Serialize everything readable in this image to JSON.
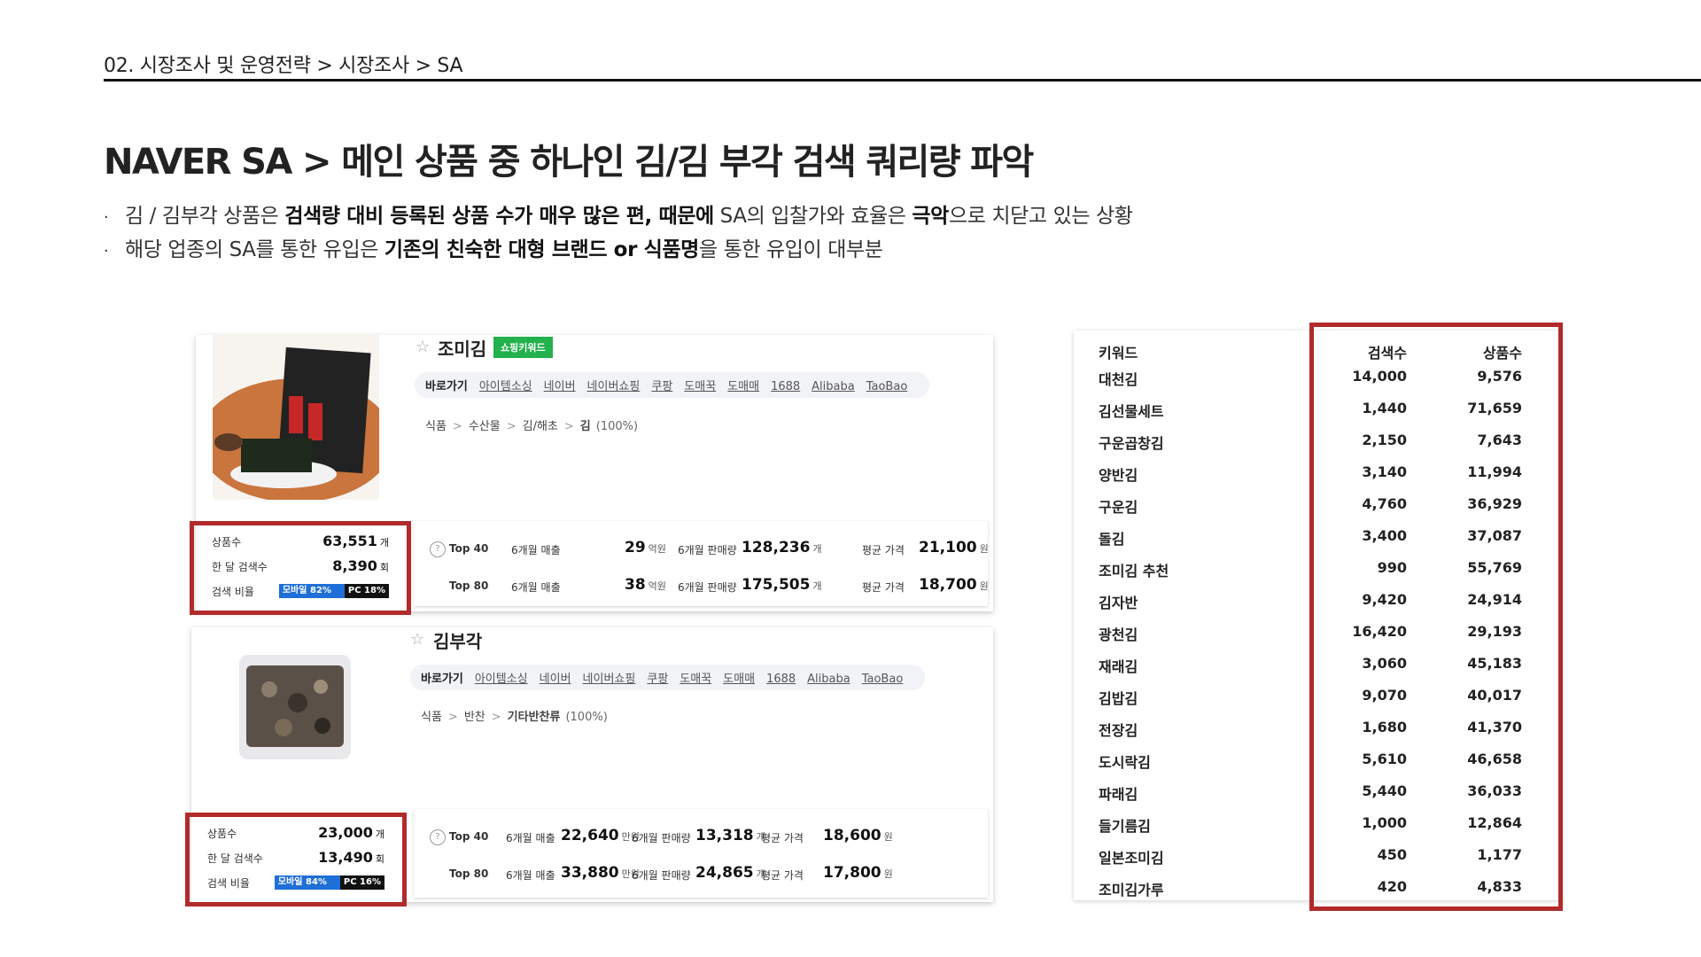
{
  "breadcrumb": "02. 시장조사 및 운영전략  >  시장조사 > SA",
  "title": "NAVER SA >  메인 상품 중 하나인 김/김 부각 검색 쿼리량 파악",
  "bullets": [
    {
      "parts": [
        {
          "t": "김 / 김부각 상품은 ",
          "b": false
        },
        {
          "t": "검색량 대비 등록된 상품 수가 매우 많은 편, 때문에",
          "b": true
        },
        {
          "t": " SA의 입찰가와 효율은 ",
          "b": false
        },
        {
          "t": "극악",
          "b": true
        },
        {
          "t": "으로 치닫고 있는 상황",
          "b": false
        }
      ]
    },
    {
      "parts": [
        {
          "t": "해당 업종의 SA를 통한 유입은 ",
          "b": false
        },
        {
          "t": "기존의 친숙한 대형 브랜드 or 식품명",
          "b": true
        },
        {
          "t": "을 통한 유입이 대부분",
          "b": false
        }
      ]
    }
  ],
  "card1": {
    "name": "조미김",
    "badge": "쇼핑키워드",
    "links": [
      "바로가기",
      "아이템소싱",
      "네이버",
      "네이버쇼핑",
      "쿠팡",
      "도매꾹",
      "도매매",
      "1688",
      "Alibaba",
      "TaoBao"
    ],
    "category": [
      "식품",
      "수산물",
      "김/해초",
      "김"
    ],
    "category_pct": "(100%)",
    "stats": {
      "products_label": "상품수",
      "products": "63,551",
      "products_unit": "개",
      "monthly_label": "한 달 검색수",
      "monthly": "8,390",
      "monthly_unit": "회",
      "ratio_label": "검색 비율",
      "mobile": "모바일 82%",
      "pc": "PC 18%",
      "mobile_pct": 82
    },
    "sales": [
      {
        "top": "Top 40",
        "rev_label": "6개월 매출",
        "rev": "29",
        "rev_unit": "억원",
        "qty_label": "6개월 판매량",
        "qty": "128,236",
        "qty_unit": "개",
        "price_label": "평균 가격",
        "price": "21,100",
        "price_unit": "원"
      },
      {
        "top": "Top 80",
        "rev_label": "6개월 매출",
        "rev": "38",
        "rev_unit": "억원",
        "qty_label": "6개월 판매량",
        "qty": "175,505",
        "qty_unit": "개",
        "price_label": "평균 가격",
        "price": "18,700",
        "price_unit": "원"
      }
    ]
  },
  "card2": {
    "name": "김부각",
    "links": [
      "바로가기",
      "아이템소싱",
      "네이버",
      "네이버쇼핑",
      "쿠팡",
      "도매꾹",
      "도매매",
      "1688",
      "Alibaba",
      "TaoBao"
    ],
    "category": [
      "식품",
      "반찬",
      "기타반찬류"
    ],
    "category_pct": "(100%)",
    "stats": {
      "products_label": "상품수",
      "products": "23,000",
      "products_unit": "개",
      "monthly_label": "한 달 검색수",
      "monthly": "13,490",
      "monthly_unit": "회",
      "ratio_label": "검색 비율",
      "mobile": "모바일 84%",
      "pc": "PC 16%",
      "mobile_pct": 84
    },
    "sales": [
      {
        "top": "Top 40",
        "rev_label": "6개월 매출",
        "rev": "22,640",
        "rev_unit": "만원",
        "qty_label": "6개월 판매량",
        "qty": "13,318",
        "qty_unit": "개",
        "price_label": "평균 가격",
        "price": "18,600",
        "price_unit": "원"
      },
      {
        "top": "Top 80",
        "rev_label": "6개월 매출",
        "rev": "33,880",
        "rev_unit": "만원",
        "qty_label": "6개월 판매량",
        "qty": "24,865",
        "qty_unit": "개",
        "price_label": "평균 가격",
        "price": "17,800",
        "price_unit": "원"
      }
    ]
  },
  "keyword_table": {
    "headers": [
      "키워드",
      "검색수",
      "상품수"
    ],
    "rows": [
      [
        "대천김",
        "14,000",
        "9,576"
      ],
      [
        "김선물세트",
        "1,440",
        "71,659"
      ],
      [
        "구운곱창김",
        "2,150",
        "7,643"
      ],
      [
        "양반김",
        "3,140",
        "11,994"
      ],
      [
        "구운김",
        "4,760",
        "36,929"
      ],
      [
        "돌김",
        "3,400",
        "37,087"
      ],
      [
        "조미김 추천",
        "990",
        "55,769"
      ],
      [
        "김자반",
        "9,420",
        "24,914"
      ],
      [
        "광천김",
        "16,420",
        "29,193"
      ],
      [
        "재래김",
        "3,060",
        "45,183"
      ],
      [
        "김밥김",
        "9,070",
        "40,017"
      ],
      [
        "전장김",
        "1,680",
        "41,370"
      ],
      [
        "도시락김",
        "5,610",
        "46,658"
      ],
      [
        "파래김",
        "5,440",
        "36,033"
      ],
      [
        "들기름김",
        "1,000",
        "12,864"
      ],
      [
        "일본조미김",
        "450",
        "1,177"
      ],
      [
        "조미김가루",
        "420",
        "4,833"
      ]
    ]
  },
  "colors": {
    "highlight_border": "#b22a2a",
    "badge_green": "#22b14c",
    "mobile_blue": "#1f6fd8"
  }
}
